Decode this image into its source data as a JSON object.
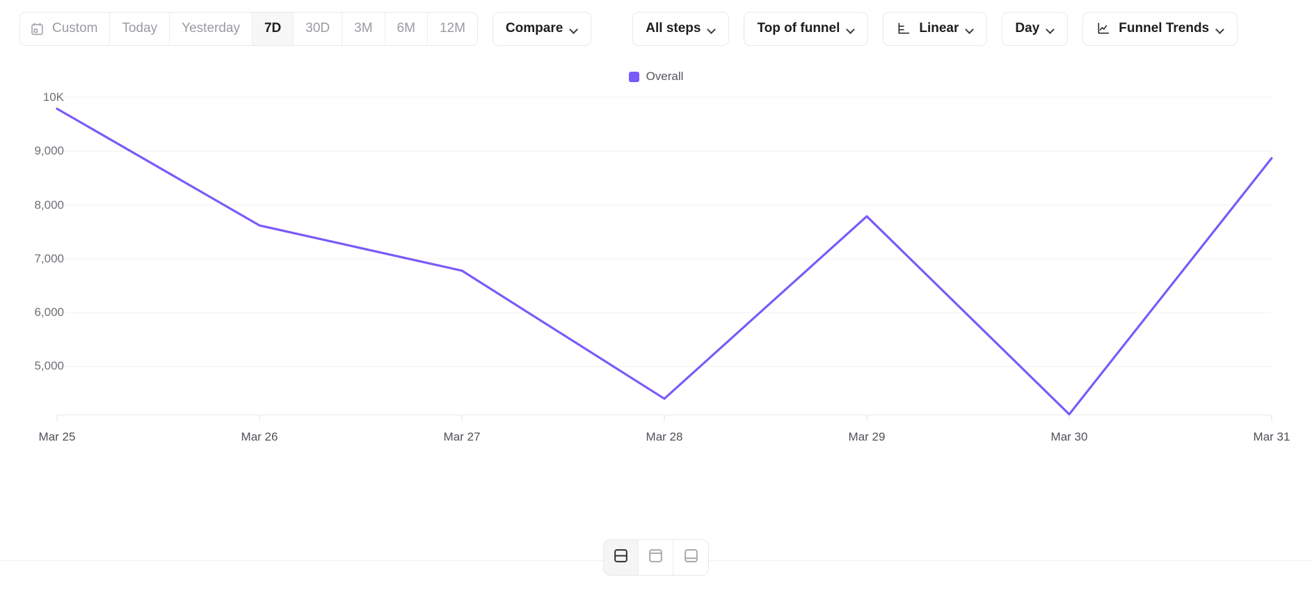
{
  "toolbar": {
    "date_segments": [
      {
        "label": "Custom",
        "icon": "calendar-icon",
        "active": false
      },
      {
        "label": "Today",
        "icon": null,
        "active": false
      },
      {
        "label": "Yesterday",
        "icon": null,
        "active": false
      },
      {
        "label": "7D",
        "icon": null,
        "active": true
      },
      {
        "label": "30D",
        "icon": null,
        "active": false
      },
      {
        "label": "3M",
        "icon": null,
        "active": false
      },
      {
        "label": "6M",
        "icon": null,
        "active": false
      },
      {
        "label": "12M",
        "icon": null,
        "active": false
      }
    ],
    "compare": {
      "label": "Compare",
      "icon": "chevron-down-icon"
    },
    "steps": {
      "label": "All steps",
      "icon": "chevron-down-icon"
    },
    "funnel_position": {
      "label": "Top of funnel",
      "icon": "chevron-down-icon"
    },
    "scale": {
      "label": "Linear",
      "icon": "axis-chart-icon"
    },
    "granularity": {
      "label": "Day",
      "icon": "chevron-down-icon"
    },
    "view": {
      "label": "Funnel Trends",
      "icon": "line-chart-icon"
    }
  },
  "legend": {
    "items": [
      {
        "label": "Overall",
        "color": "#7a5af8"
      }
    ]
  },
  "layout_switcher": {
    "buttons": [
      {
        "name": "layout-split-even",
        "icon": "split-even-icon",
        "active": true
      },
      {
        "name": "layout-top-heavy",
        "icon": "top-heavy-icon",
        "active": false
      },
      {
        "name": "layout-bottom-heavy",
        "icon": "bottom-heavy-icon",
        "active": false
      }
    ]
  },
  "chart_data": {
    "type": "line",
    "title": "",
    "xlabel": "",
    "ylabel": "",
    "grid": true,
    "legend_position": "top-center",
    "line_color": "#7a5af8",
    "x": [
      "Mar 25",
      "Mar 26",
      "Mar 27",
      "Mar 28",
      "Mar 29",
      "Mar 30",
      "Mar 31"
    ],
    "ytick_labels": [
      "10K",
      "9,000",
      "8,000",
      "7,000",
      "6,000",
      "5,000"
    ],
    "ytick_values": [
      10000,
      9000,
      8000,
      7000,
      6000,
      5000
    ],
    "ylim": [
      4100,
      10000
    ],
    "series": [
      {
        "name": "Overall",
        "color": "#7a5af8",
        "values": [
          9790,
          7620,
          6780,
          4400,
          7790,
          4110,
          8870
        ]
      }
    ]
  }
}
